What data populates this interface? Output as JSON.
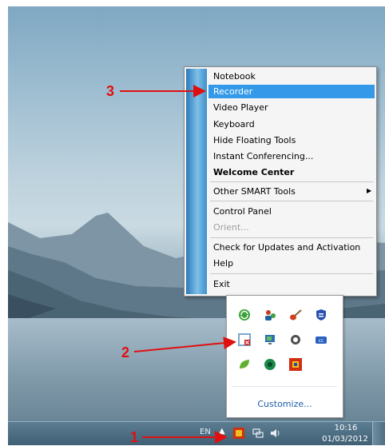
{
  "menu": {
    "items": [
      {
        "label": "Notebook"
      },
      {
        "label": "Recorder"
      },
      {
        "label": "Video Player"
      },
      {
        "label": "Keyboard"
      },
      {
        "label": "Hide Floating Tools"
      },
      {
        "label": "Instant Conferencing..."
      },
      {
        "label": "Welcome Center"
      },
      {
        "label": "Other SMART Tools"
      },
      {
        "label": "Control Panel"
      },
      {
        "label": "Orient..."
      },
      {
        "label": "Check for Updates and Activation"
      },
      {
        "label": "Help"
      },
      {
        "label": "Exit"
      }
    ],
    "highlight_color": "#3399e8"
  },
  "tray": {
    "customize_label": "Customize..."
  },
  "taskbar": {
    "language": "EN",
    "time": "10:16",
    "date": "01/03/2012"
  },
  "annotations": {
    "step1": "1",
    "step2": "2",
    "step3": "3",
    "color": "#e01010"
  }
}
